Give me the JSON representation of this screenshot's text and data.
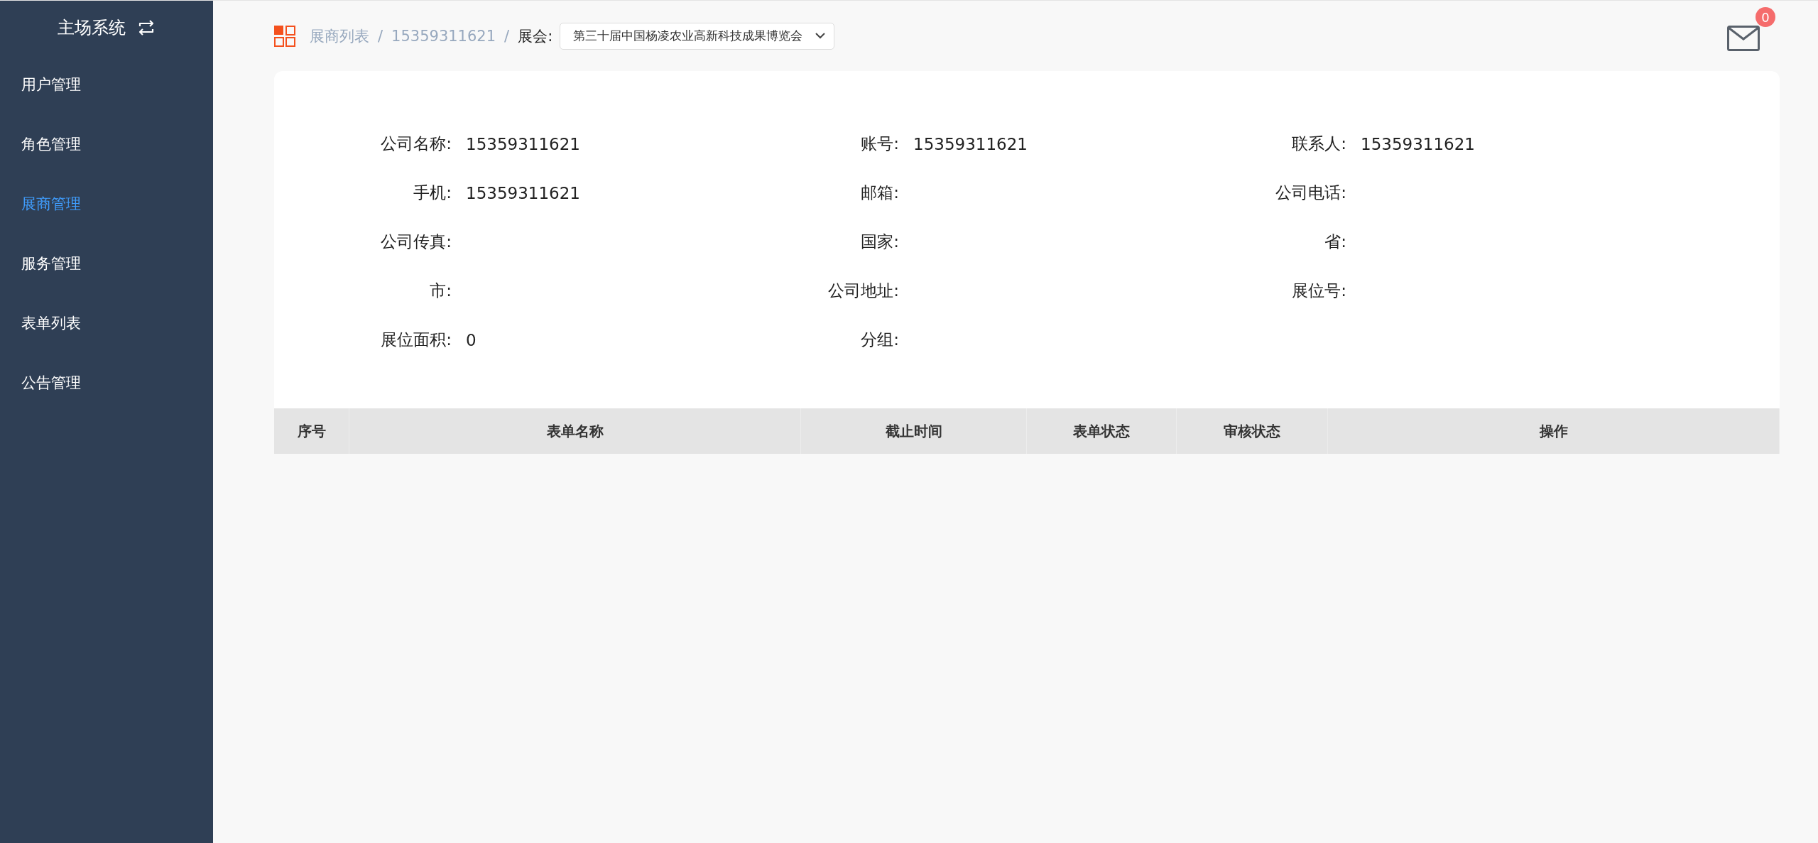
{
  "sidebar": {
    "title": "主场系统",
    "items": [
      {
        "label": "用户管理",
        "selected": false
      },
      {
        "label": "角色管理",
        "selected": false
      },
      {
        "label": "展商管理",
        "selected": true
      },
      {
        "label": "服务管理",
        "selected": false
      },
      {
        "label": "表单列表",
        "selected": false
      },
      {
        "label": "公告管理",
        "selected": false
      }
    ]
  },
  "breadcrumb": {
    "items": [
      "展商列表",
      "15359311621"
    ],
    "separator": "/",
    "exhibition_label": "展会:",
    "exhibition_value": "第三十届中国杨凌农业高新科技成果博览会"
  },
  "mail": {
    "badge": "0"
  },
  "info": [
    {
      "label": "公司名称:",
      "value": "15359311621"
    },
    {
      "label": "账号:",
      "value": "15359311621"
    },
    {
      "label": "联系人:",
      "value": "15359311621"
    },
    {
      "label": "手机:",
      "value": "15359311621"
    },
    {
      "label": "邮箱:"
    },
    {
      "label": "公司电话:"
    },
    {
      "label": "公司传真:"
    },
    {
      "label": "国家:"
    },
    {
      "label": "省:"
    },
    {
      "label": "市:"
    },
    {
      "label": "公司地址:"
    },
    {
      "label": "展位号:"
    },
    {
      "label": "展位面积:",
      "value": "0"
    },
    {
      "label": "分组:"
    }
  ],
  "table": {
    "columns": [
      "序号",
      "表单名称",
      "截止时间",
      "表单状态",
      "审核状态",
      "操作"
    ]
  }
}
